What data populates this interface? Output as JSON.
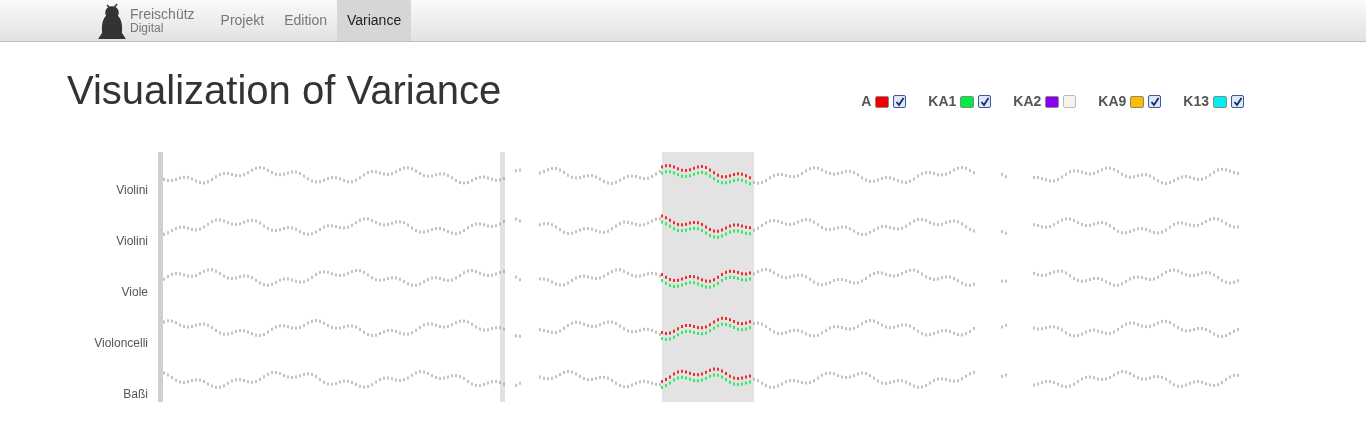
{
  "navbar": {
    "brand": {
      "title": "Freischütz",
      "subtitle": "Digital"
    },
    "tabs": [
      {
        "label": "Projekt",
        "selected": false
      },
      {
        "label": "Edition",
        "selected": false
      },
      {
        "label": "Variance",
        "selected": true
      }
    ]
  },
  "title": "Visualization of Variance",
  "legend": [
    {
      "label": "A",
      "color": "#ee0000",
      "checked": true
    },
    {
      "label": "KA1",
      "color": "#00ee44",
      "checked": true
    },
    {
      "label": "KA2",
      "color": "#8800ee",
      "checked": false
    },
    {
      "label": "KA9",
      "color": "#ffbb00",
      "checked": true
    },
    {
      "label": "K13",
      "color": "#00f0f0",
      "checked": true
    }
  ],
  "staves": [
    "Violini",
    "Violini",
    "Viole",
    "Violoncelli",
    "Baßi"
  ]
}
